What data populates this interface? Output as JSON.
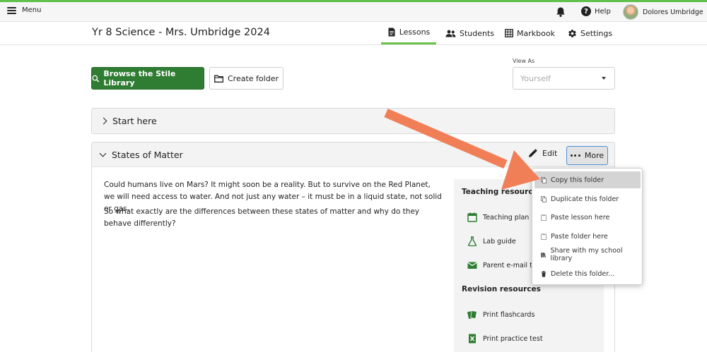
{
  "topbar": {
    "menu_label": "Menu",
    "help_label": "Help",
    "user_name": "Dolores Umbridge",
    "accent_color": "#5fc24a"
  },
  "subheader": {
    "course_title": "Yr 8 Science - Mrs. Umbridge 2024",
    "tabs": [
      {
        "label": "Lessons",
        "icon": "document-icon",
        "active": true
      },
      {
        "label": "Students",
        "icon": "people-icon",
        "active": false
      },
      {
        "label": "Markbook",
        "icon": "grid-icon",
        "active": false
      },
      {
        "label": "Settings",
        "icon": "gear-icon",
        "active": false
      }
    ]
  },
  "toolbar": {
    "browse_label": "Browse the Stile Library",
    "create_folder_label": "Create folder",
    "view_as_label": "View As",
    "view_as_value": "Yourself",
    "brand_color": "#2e7d32"
  },
  "folders": [
    {
      "title": "Start here",
      "expanded": false
    },
    {
      "title": "States of Matter",
      "expanded": true,
      "edit_label": "Edit",
      "more_label": "More",
      "paragraphs": [
        "Could humans live on Mars? It might soon be a reality. But to survive on the Red Planet, we will need access to water. And not just any water – it must be in a liquid state, not solid or gas.",
        "So what exactly are the differences between these states of matter and why do they behave differently?"
      ],
      "teaching_heading": "Teaching resources",
      "teaching_items": [
        {
          "label": "Teaching plan",
          "icon": "calendar-icon"
        },
        {
          "label": "Lab guide",
          "icon": "flask-icon"
        },
        {
          "label": "Parent e-mail te",
          "icon": "envelope-icon"
        }
      ],
      "revision_heading": "Revision resources",
      "revision_items": [
        {
          "label": "Print flashcards",
          "icon": "flashcards-icon"
        },
        {
          "label": "Print practice test",
          "icon": "spreadsheet-icon"
        }
      ]
    }
  ],
  "more_menu": {
    "items": [
      {
        "label": "Copy this folder",
        "icon": "copy-icon",
        "highlighted": true
      },
      {
        "label": "Duplicate this folder",
        "icon": "copy-icon",
        "highlighted": false
      },
      {
        "label": "Paste lesson here",
        "icon": "paste-icon",
        "highlighted": false
      },
      {
        "label": "Paste folder here",
        "icon": "paste-icon",
        "highlighted": false
      },
      {
        "label": "Share with my school library",
        "icon": "library-icon",
        "highlighted": false
      },
      {
        "label": "Delete this folder...",
        "icon": "trash-icon",
        "highlighted": false
      }
    ]
  },
  "annotation": {
    "arrow_color": "#f07f57"
  }
}
